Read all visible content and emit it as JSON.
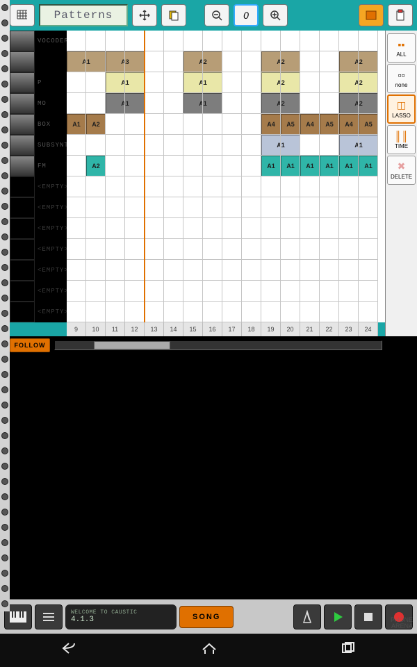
{
  "toolbar": {
    "patterns_label": "Patterns",
    "undo_icon": "clipboard-paste-icon",
    "zoom_reset_label": "0"
  },
  "rightbar": {
    "all": "ALL",
    "none": "none",
    "lasso": "LASSO",
    "time": "TIME",
    "delete": "DELETE"
  },
  "tracks": [
    {
      "name": "VOCODER",
      "empty": false
    },
    {
      "name": "",
      "empty": false
    },
    {
      "name": "P",
      "empty": false
    },
    {
      "name": "MO",
      "empty": false
    },
    {
      "name": "BOX",
      "empty": false
    },
    {
      "name": "SUBSYNTH",
      "empty": false
    },
    {
      "name": "FM",
      "empty": false
    },
    {
      "name": "<EMPTY>",
      "empty": true
    },
    {
      "name": "<EMPTY>",
      "empty": true
    },
    {
      "name": "<EMPTY>",
      "empty": true
    },
    {
      "name": "<EMPTY>",
      "empty": true
    },
    {
      "name": "<EMPTY>",
      "empty": true
    },
    {
      "name": "<EMPTY>",
      "empty": true
    },
    {
      "name": "<EMPTY>",
      "empty": true
    }
  ],
  "timeline": [
    "9",
    "10",
    "11",
    "12",
    "13",
    "14",
    "15",
    "16",
    "17",
    "18",
    "19",
    "20",
    "21",
    "22",
    "23",
    "24"
  ],
  "clips": [
    {
      "row": 1,
      "col": 0,
      "span": 2,
      "label": "A1",
      "color": "#b79d76"
    },
    {
      "row": 1,
      "col": 2,
      "span": 2,
      "label": "A3",
      "color": "#b79d76"
    },
    {
      "row": 1,
      "col": 6,
      "span": 2,
      "label": "A2",
      "color": "#b79d76"
    },
    {
      "row": 1,
      "col": 10,
      "span": 2,
      "label": "A2",
      "color": "#b79d76"
    },
    {
      "row": 1,
      "col": 14,
      "span": 2,
      "label": "A2",
      "color": "#b79d76"
    },
    {
      "row": 2,
      "col": 2,
      "span": 2,
      "label": "A1",
      "color": "#e9e7a8"
    },
    {
      "row": 2,
      "col": 6,
      "span": 2,
      "label": "A1",
      "color": "#e9e7a8"
    },
    {
      "row": 2,
      "col": 10,
      "span": 2,
      "label": "A2",
      "color": "#e9e7a8"
    },
    {
      "row": 2,
      "col": 14,
      "span": 2,
      "label": "A2",
      "color": "#e9e7a8"
    },
    {
      "row": 3,
      "col": 2,
      "span": 2,
      "label": "A1",
      "color": "#7d7d7d"
    },
    {
      "row": 3,
      "col": 6,
      "span": 2,
      "label": "A1",
      "color": "#7d7d7d"
    },
    {
      "row": 3,
      "col": 10,
      "span": 2,
      "label": "A2",
      "color": "#7d7d7d"
    },
    {
      "row": 3,
      "col": 14,
      "span": 2,
      "label": "A2",
      "color": "#7d7d7d"
    },
    {
      "row": 4,
      "col": 0,
      "span": 1,
      "label": "A1",
      "color": "#a57b4b"
    },
    {
      "row": 4,
      "col": 1,
      "span": 1,
      "label": "A2",
      "color": "#a57b4b"
    },
    {
      "row": 4,
      "col": 10,
      "span": 1,
      "label": "A4",
      "color": "#a57b4b"
    },
    {
      "row": 4,
      "col": 11,
      "span": 1,
      "label": "A5",
      "color": "#a57b4b"
    },
    {
      "row": 4,
      "col": 12,
      "span": 1,
      "label": "A4",
      "color": "#a57b4b"
    },
    {
      "row": 4,
      "col": 13,
      "span": 1,
      "label": "A5",
      "color": "#a57b4b"
    },
    {
      "row": 4,
      "col": 14,
      "span": 1,
      "label": "A4",
      "color": "#a57b4b"
    },
    {
      "row": 4,
      "col": 15,
      "span": 1,
      "label": "A5",
      "color": "#a57b4b"
    },
    {
      "row": 5,
      "col": 10,
      "span": 2,
      "label": "A1",
      "color": "#b9c4d8"
    },
    {
      "row": 5,
      "col": 14,
      "span": 2,
      "label": "A1",
      "color": "#b9c4d8"
    },
    {
      "row": 6,
      "col": 1,
      "span": 1,
      "label": "A2",
      "color": "#2fb5a8"
    },
    {
      "row": 6,
      "col": 10,
      "span": 1,
      "label": "A1",
      "color": "#2fb5a8"
    },
    {
      "row": 6,
      "col": 11,
      "span": 1,
      "label": "A1",
      "color": "#2fb5a8"
    },
    {
      "row": 6,
      "col": 12,
      "span": 1,
      "label": "A1",
      "color": "#2fb5a8"
    },
    {
      "row": 6,
      "col": 13,
      "span": 1,
      "label": "A1",
      "color": "#2fb5a8"
    },
    {
      "row": 6,
      "col": 14,
      "span": 1,
      "label": "A1",
      "color": "#2fb5a8"
    },
    {
      "row": 6,
      "col": 15,
      "span": 1,
      "label": "A1",
      "color": "#2fb5a8"
    }
  ],
  "followbar": {
    "follow_label": "FOLLOW"
  },
  "transport": {
    "lcd_line1": "WELCOME TO CAUSTIC",
    "lcd_line2": "4.1.3",
    "song_label": "SONG"
  },
  "watermark": "PHONE\nARENA"
}
